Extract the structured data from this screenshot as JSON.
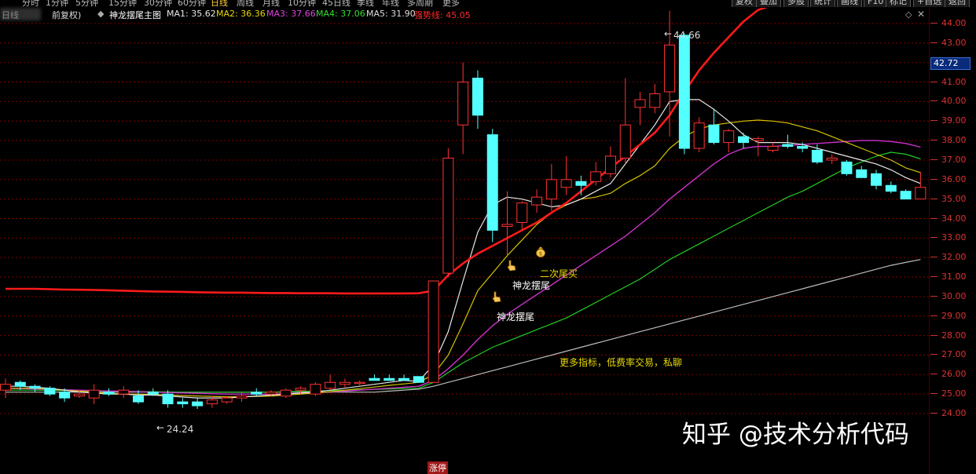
{
  "periods": [
    "分时",
    "1分钟",
    "5分钟",
    "15分钟",
    "30分钟",
    "60分钟",
    "日线",
    "周线",
    "月线",
    "10分钟",
    "45日线",
    "季线",
    "年线",
    "多周期",
    "更多"
  ],
  "active_period": "日线",
  "toolbar": {
    "fuquan": "复权",
    "diejia": "叠加",
    "duogu": "多股",
    "tongji": "统计",
    "huaxian": "画线",
    "f10": "F10",
    "biaoji": "标记",
    "zixuan": "+自选",
    "fanhui": "返回"
  },
  "info": {
    "blurred_prefix": "日线",
    "mode": "前复权)",
    "indicator_name": "神龙摆尾主图",
    "ma1": "MA1: 35.62",
    "ma2": "MA2: 36.36",
    "ma3": "MA3: 37.66",
    "ma4": "MA4: 37.06",
    "ma5": "MA5: 31.90",
    "qiangshi": "强势线: 45.05"
  },
  "axis": {
    "ticks": [
      "44.00",
      "43.00",
      "42.00",
      "41.00",
      "40.00",
      "39.00",
      "38.00",
      "37.00",
      "36.00",
      "35.00",
      "34.00",
      "33.00",
      "32.00",
      "31.00",
      "30.00",
      "29.00",
      "28.00",
      "27.00",
      "26.00",
      "25.00",
      "24.00"
    ],
    "current_price": "42.72"
  },
  "annotations": {
    "high": "44.66",
    "low": "24.24",
    "second_tail_buy": "二次尾买",
    "shenlong_1": "神龙摆尾",
    "shenlong_2": "神龙摆尾",
    "more_indicators": "更多指标，低费率交易，私聊"
  },
  "watermark": "知乎 @技术分析代码",
  "bottom_label": "涨停",
  "colors": {
    "up": "#ff3232",
    "down": "#54ffff",
    "strong_line": "#ff1a1a",
    "ma1": "#e8e8e8",
    "ma2": "#d4c400",
    "ma3": "#cc33cc",
    "ma4": "#22cc22",
    "ma5": "#bbbbbb",
    "grid": "#7a0000"
  },
  "chart_data": {
    "type": "candlestick",
    "y_range": [
      23.5,
      45.0
    ],
    "candles": [
      {
        "o": 25.2,
        "h": 25.8,
        "l": 24.8,
        "c": 25.5
      },
      {
        "o": 25.6,
        "h": 25.7,
        "l": 25.2,
        "c": 25.4
      },
      {
        "o": 25.4,
        "h": 25.5,
        "l": 25.1,
        "c": 25.3
      },
      {
        "o": 25.3,
        "h": 25.4,
        "l": 24.9,
        "c": 25.0
      },
      {
        "o": 25.1,
        "h": 25.3,
        "l": 24.6,
        "c": 24.8
      },
      {
        "o": 24.9,
        "h": 25.2,
        "l": 24.8,
        "c": 25.0
      },
      {
        "o": 24.8,
        "h": 25.5,
        "l": 24.5,
        "c": 25.2
      },
      {
        "o": 25.1,
        "h": 25.3,
        "l": 24.9,
        "c": 25.0
      },
      {
        "o": 25.0,
        "h": 25.4,
        "l": 24.8,
        "c": 25.2
      },
      {
        "o": 24.9,
        "h": 25.2,
        "l": 24.5,
        "c": 24.6
      },
      {
        "o": 25.1,
        "h": 25.3,
        "l": 24.9,
        "c": 25.0
      },
      {
        "o": 25.0,
        "h": 25.2,
        "l": 24.3,
        "c": 24.5
      },
      {
        "o": 24.6,
        "h": 24.8,
        "l": 24.3,
        "c": 24.5
      },
      {
        "o": 24.6,
        "h": 24.8,
        "l": 24.24,
        "c": 24.4
      },
      {
        "o": 24.5,
        "h": 24.9,
        "l": 24.3,
        "c": 24.7
      },
      {
        "o": 24.6,
        "h": 24.9,
        "l": 24.5,
        "c": 24.8
      },
      {
        "o": 24.8,
        "h": 25.1,
        "l": 24.6,
        "c": 24.9
      },
      {
        "o": 25.1,
        "h": 25.3,
        "l": 24.9,
        "c": 25.0
      },
      {
        "o": 25.0,
        "h": 25.2,
        "l": 24.9,
        "c": 25.1
      },
      {
        "o": 24.9,
        "h": 25.3,
        "l": 24.8,
        "c": 25.2
      },
      {
        "o": 25.2,
        "h": 25.4,
        "l": 25.0,
        "c": 25.3
      },
      {
        "o": 25.0,
        "h": 25.6,
        "l": 24.9,
        "c": 25.5
      },
      {
        "o": 25.3,
        "h": 26.0,
        "l": 25.2,
        "c": 25.6
      },
      {
        "o": 25.5,
        "h": 25.8,
        "l": 25.3,
        "c": 25.6
      },
      {
        "o": 25.6,
        "h": 25.7,
        "l": 25.4,
        "c": 25.6
      },
      {
        "o": 25.8,
        "h": 26.0,
        "l": 25.7,
        "c": 25.7
      },
      {
        "o": 25.8,
        "h": 26.0,
        "l": 25.7,
        "c": 25.7
      },
      {
        "o": 25.8,
        "h": 26.0,
        "l": 25.7,
        "c": 25.7
      },
      {
        "o": 25.9,
        "h": 25.9,
        "l": 25.6,
        "c": 25.6
      },
      {
        "o": 25.6,
        "h": 30.8,
        "l": 25.6,
        "c": 30.8
      },
      {
        "o": 31.2,
        "h": 37.6,
        "l": 31.0,
        "c": 37.1
      },
      {
        "o": 38.8,
        "h": 42.0,
        "l": 37.3,
        "c": 41.0
      },
      {
        "o": 41.2,
        "h": 41.6,
        "l": 38.6,
        "c": 39.3
      },
      {
        "o": 38.3,
        "h": 38.6,
        "l": 32.8,
        "c": 33.4
      },
      {
        "o": 33.6,
        "h": 35.4,
        "l": 32.1,
        "c": 33.7
      },
      {
        "o": 33.8,
        "h": 34.9,
        "l": 33.4,
        "c": 34.8
      },
      {
        "o": 34.7,
        "h": 35.5,
        "l": 34.3,
        "c": 35.1
      },
      {
        "o": 35.0,
        "h": 36.8,
        "l": 34.4,
        "c": 36.0
      },
      {
        "o": 35.6,
        "h": 37.2,
        "l": 35.2,
        "c": 36.0
      },
      {
        "o": 35.9,
        "h": 36.2,
        "l": 35.2,
        "c": 35.7
      },
      {
        "o": 35.9,
        "h": 36.9,
        "l": 35.7,
        "c": 36.4
      },
      {
        "o": 36.3,
        "h": 37.7,
        "l": 36.1,
        "c": 37.2
      },
      {
        "o": 37.1,
        "h": 41.2,
        "l": 36.8,
        "c": 38.8
      },
      {
        "o": 39.7,
        "h": 40.5,
        "l": 38.8,
        "c": 40.1
      },
      {
        "o": 39.7,
        "h": 40.9,
        "l": 39.4,
        "c": 40.4
      },
      {
        "o": 40.5,
        "h": 44.66,
        "l": 38.2,
        "c": 42.9
      },
      {
        "o": 43.4,
        "h": 43.5,
        "l": 37.3,
        "c": 37.6
      },
      {
        "o": 37.6,
        "h": 39.2,
        "l": 37.4,
        "c": 38.9
      },
      {
        "o": 38.8,
        "h": 39.6,
        "l": 37.8,
        "c": 37.9
      },
      {
        "o": 37.9,
        "h": 38.6,
        "l": 37.4,
        "c": 38.5
      },
      {
        "o": 38.2,
        "h": 38.4,
        "l": 37.6,
        "c": 37.9
      },
      {
        "o": 38.0,
        "h": 38.2,
        "l": 37.2,
        "c": 38.1
      },
      {
        "o": 37.5,
        "h": 37.9,
        "l": 37.4,
        "c": 37.7
      },
      {
        "o": 37.8,
        "h": 38.3,
        "l": 37.6,
        "c": 37.7
      },
      {
        "o": 37.7,
        "h": 37.9,
        "l": 37.4,
        "c": 37.6
      },
      {
        "o": 37.5,
        "h": 37.8,
        "l": 36.8,
        "c": 36.9
      },
      {
        "o": 37.0,
        "h": 37.3,
        "l": 36.8,
        "c": 37.1
      },
      {
        "o": 36.9,
        "h": 37.0,
        "l": 36.2,
        "c": 36.3
      },
      {
        "o": 36.5,
        "h": 36.7,
        "l": 36.1,
        "c": 36.1
      },
      {
        "o": 36.3,
        "h": 36.5,
        "l": 35.5,
        "c": 35.7
      },
      {
        "o": 35.7,
        "h": 35.9,
        "l": 35.3,
        "c": 35.4
      },
      {
        "o": 35.4,
        "h": 35.5,
        "l": 35.0,
        "c": 35.0
      },
      {
        "o": 35.0,
        "h": 36.4,
        "l": 35.0,
        "c": 35.6
      }
    ],
    "lines": {
      "strong": [
        30.4,
        30.4,
        30.4,
        30.38,
        30.36,
        30.35,
        30.34,
        30.32,
        30.3,
        30.28,
        30.26,
        30.25,
        30.24,
        30.22,
        30.21,
        30.2,
        30.2,
        30.19,
        30.18,
        30.18,
        30.17,
        30.17,
        30.17,
        30.16,
        30.16,
        30.16,
        30.16,
        30.16,
        30.17,
        30.3,
        31.1,
        31.7,
        32.2,
        32.6,
        33.0,
        33.4,
        33.8,
        34.3,
        34.8,
        35.4,
        36.0,
        36.6,
        37.2,
        37.8,
        38.4,
        39.3,
        40.5,
        41.6,
        42.5,
        43.3,
        44.1,
        44.7,
        44.95,
        45.05,
        45.0,
        44.92,
        44.9,
        44.95,
        45.0,
        45.05,
        45.05,
        45.04,
        45.02
      ],
      "ma1": [
        25.4,
        25.4,
        25.35,
        25.3,
        25.2,
        25.1,
        25.05,
        25.0,
        25.0,
        24.95,
        24.95,
        24.9,
        24.85,
        24.8,
        24.8,
        24.8,
        24.85,
        24.9,
        24.95,
        25.0,
        25.05,
        25.1,
        25.2,
        25.3,
        25.4,
        25.5,
        25.6,
        25.7,
        25.65,
        26.5,
        28.2,
        30.8,
        33.3,
        34.7,
        35.1,
        35.0,
        34.8,
        34.6,
        34.7,
        35.0,
        35.4,
        35.8,
        36.8,
        37.8,
        38.8,
        40.0,
        40.1,
        40.1,
        39.6,
        39.0,
        38.3,
        37.9,
        37.9,
        37.9,
        37.8,
        37.6,
        37.4,
        37.2,
        37.0,
        36.8,
        36.5,
        36.1,
        35.8
      ],
      "ma2": [
        25.3,
        25.3,
        25.3,
        25.25,
        25.2,
        25.15,
        25.1,
        25.05,
        25.0,
        25.0,
        24.98,
        24.95,
        24.92,
        24.9,
        24.88,
        24.86,
        24.86,
        24.88,
        24.9,
        24.95,
        25.0,
        25.05,
        25.12,
        25.2,
        25.28,
        25.36,
        25.45,
        25.52,
        25.6,
        26.0,
        27.0,
        28.6,
        30.3,
        31.2,
        32.1,
        32.9,
        33.7,
        34.3,
        34.7,
        35.0,
        35.1,
        35.3,
        35.8,
        36.2,
        36.7,
        37.6,
        38.2,
        38.6,
        38.8,
        38.9,
        39.0,
        39.05,
        39.0,
        38.9,
        38.7,
        38.5,
        38.2,
        37.9,
        37.6,
        37.3,
        37.0,
        36.6,
        36.36
      ],
      "ma3": [
        25.3,
        25.28,
        25.26,
        25.24,
        25.22,
        25.2,
        25.18,
        25.16,
        25.14,
        25.12,
        25.1,
        25.08,
        25.06,
        25.04,
        25.02,
        25.0,
        25.0,
        25.0,
        25.0,
        25.02,
        25.05,
        25.08,
        25.1,
        25.15,
        25.2,
        25.25,
        25.3,
        25.35,
        25.4,
        25.7,
        26.3,
        27.0,
        27.8,
        28.5,
        29.1,
        29.6,
        30.1,
        30.6,
        31.1,
        31.6,
        32.1,
        32.6,
        33.1,
        33.7,
        34.3,
        35.0,
        35.6,
        36.2,
        36.8,
        37.3,
        37.6,
        37.7,
        37.7,
        37.75,
        37.8,
        37.85,
        37.9,
        37.95,
        38.0,
        38.0,
        37.95,
        37.85,
        37.66
      ],
      "ma4": [
        25.2,
        25.2,
        25.2,
        25.19,
        25.18,
        25.17,
        25.16,
        25.15,
        25.14,
        25.13,
        25.12,
        25.11,
        25.1,
        25.1,
        25.1,
        25.1,
        25.1,
        25.1,
        25.1,
        25.12,
        25.14,
        25.16,
        25.18,
        25.2,
        25.22,
        25.24,
        25.26,
        25.28,
        25.3,
        25.6,
        26.1,
        26.6,
        27.0,
        27.4,
        27.7,
        28.0,
        28.3,
        28.6,
        28.9,
        29.3,
        29.7,
        30.1,
        30.5,
        30.9,
        31.4,
        31.9,
        32.3,
        32.7,
        33.1,
        33.5,
        33.9,
        34.3,
        34.7,
        35.1,
        35.4,
        35.8,
        36.2,
        36.6,
        36.9,
        37.2,
        37.4,
        37.3,
        37.06
      ],
      "ma5": [
        25.1,
        25.1,
        25.1,
        25.1,
        25.1,
        25.1,
        25.1,
        25.1,
        25.1,
        25.1,
        25.1,
        25.1,
        25.1,
        25.1,
        25.1,
        25.1,
        25.1,
        25.1,
        25.1,
        25.1,
        25.1,
        25.1,
        25.1,
        25.1,
        25.1,
        25.1,
        25.15,
        25.2,
        25.25,
        25.4,
        25.6,
        25.8,
        26.0,
        26.2,
        26.4,
        26.6,
        26.8,
        27.0,
        27.2,
        27.4,
        27.6,
        27.8,
        28.0,
        28.2,
        28.4,
        28.6,
        28.8,
        29.0,
        29.2,
        29.4,
        29.6,
        29.8,
        30.0,
        30.2,
        30.4,
        30.6,
        30.8,
        31.0,
        31.2,
        31.4,
        31.6,
        31.75,
        31.9
      ]
    }
  }
}
